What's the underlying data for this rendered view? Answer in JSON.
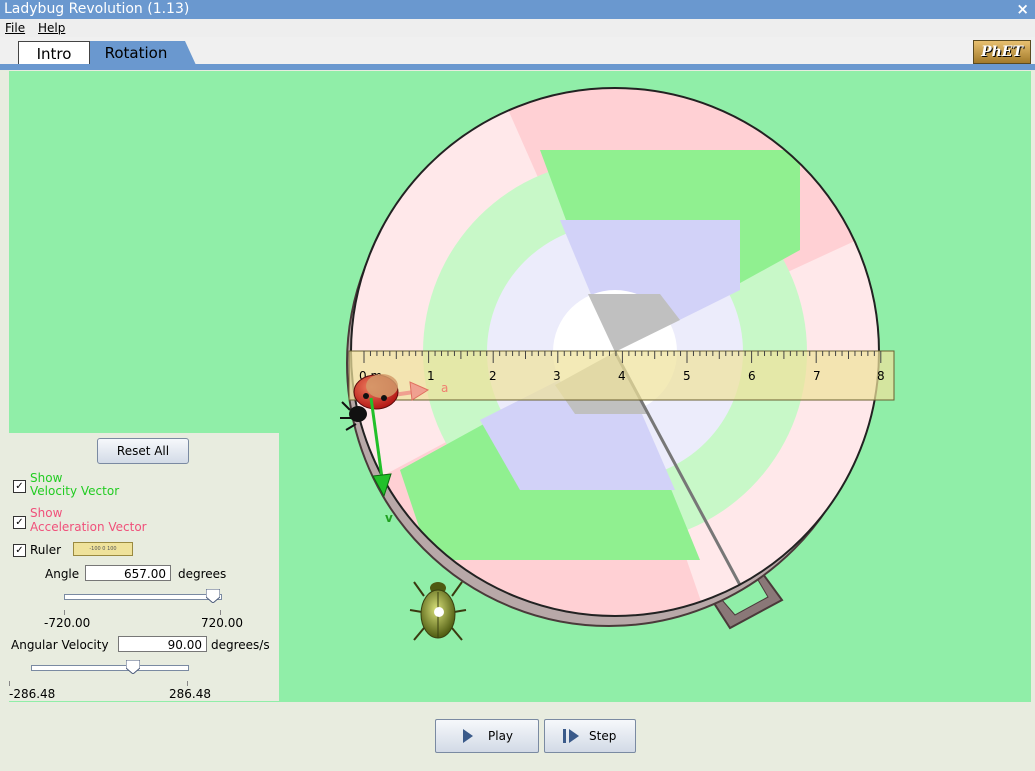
{
  "window": {
    "title": "Ladybug Revolution (1.13)",
    "close_symbol": "×"
  },
  "menu": {
    "file": "File",
    "help": "Help"
  },
  "tabs": {
    "intro": "Intro",
    "rotation": "Rotation"
  },
  "logo": "PhET",
  "ruler": {
    "unit_label": "0 m",
    "tick_labels": [
      "1",
      "2",
      "3",
      "4",
      "5",
      "6",
      "7",
      "8"
    ]
  },
  "vectors": {
    "velocity_label": "v",
    "acceleration_label": "a"
  },
  "panel": {
    "reset_label": "Reset All",
    "velocity_show": "Show",
    "velocity_label": "Velocity Vector",
    "accel_show": "Show",
    "accel_label": "Acceleration Vector",
    "ruler_label": "Ruler",
    "ruler_swatch_text": "-100   0   100",
    "checked_symbol": "✓",
    "angle_label": "Angle",
    "angle_value": "657.00",
    "angle_unit": "degrees",
    "angle_min": "-720.00",
    "angle_max": "720.00",
    "angle_fraction": 0.956,
    "angvel_label": "Angular Velocity",
    "angvel_value": "90.00",
    "angvel_unit": "degrees/s",
    "angvel_min": "-286.48",
    "angvel_max": "286.48",
    "angvel_fraction": 0.657
  },
  "controls": {
    "play": "Play",
    "step": "Step"
  },
  "colors": {
    "accent": "#6a98cf",
    "play_area": "#90eea8",
    "velocity": "#22c02a",
    "acceleration": "#f05a7a"
  }
}
